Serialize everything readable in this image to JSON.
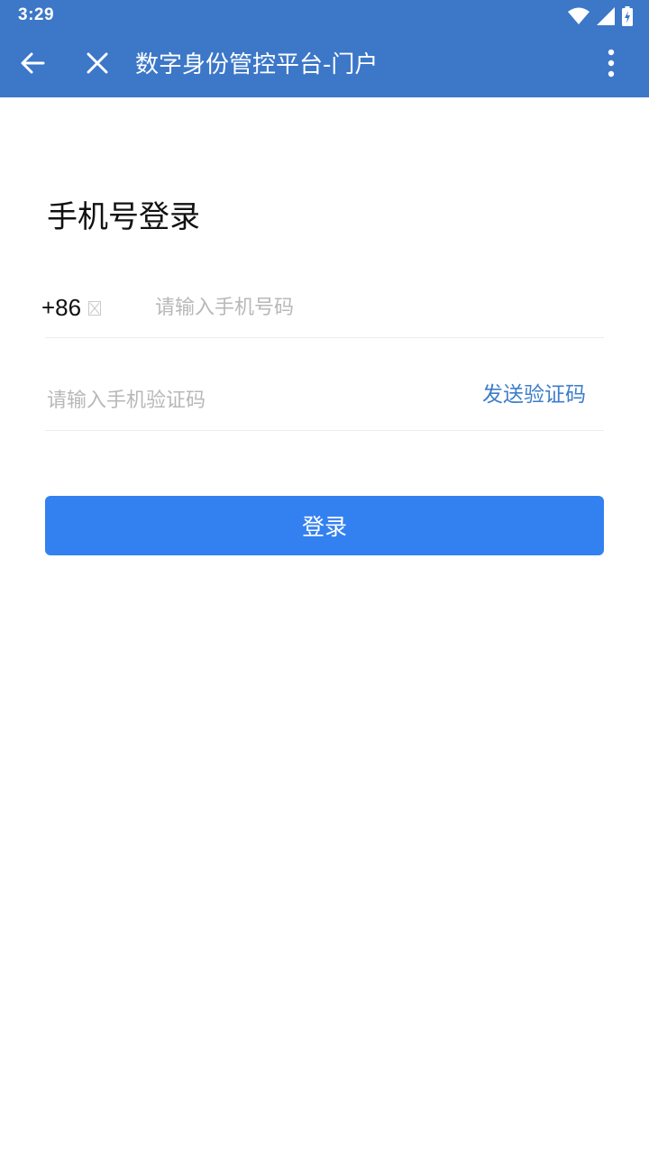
{
  "status_bar": {
    "time": "3:29",
    "icons": [
      "wifi-icon",
      "cellular-signal-icon",
      "battery-charging-icon"
    ]
  },
  "app_bar": {
    "title": "数字身份管控平台-门户",
    "back_icon": "arrow-left-icon",
    "close_icon": "close-icon",
    "menu_icon": "more-vertical-icon"
  },
  "login": {
    "heading": "手机号登录",
    "country_code": "+86",
    "phone_placeholder": "请输入手机号码",
    "code_placeholder": "请输入手机验证码",
    "send_code_label": "发送验证码",
    "submit_label": "登录"
  },
  "colors": {
    "header_bg": "#3c77c8",
    "primary_button": "#3381f0",
    "link": "#3d7ecb"
  }
}
